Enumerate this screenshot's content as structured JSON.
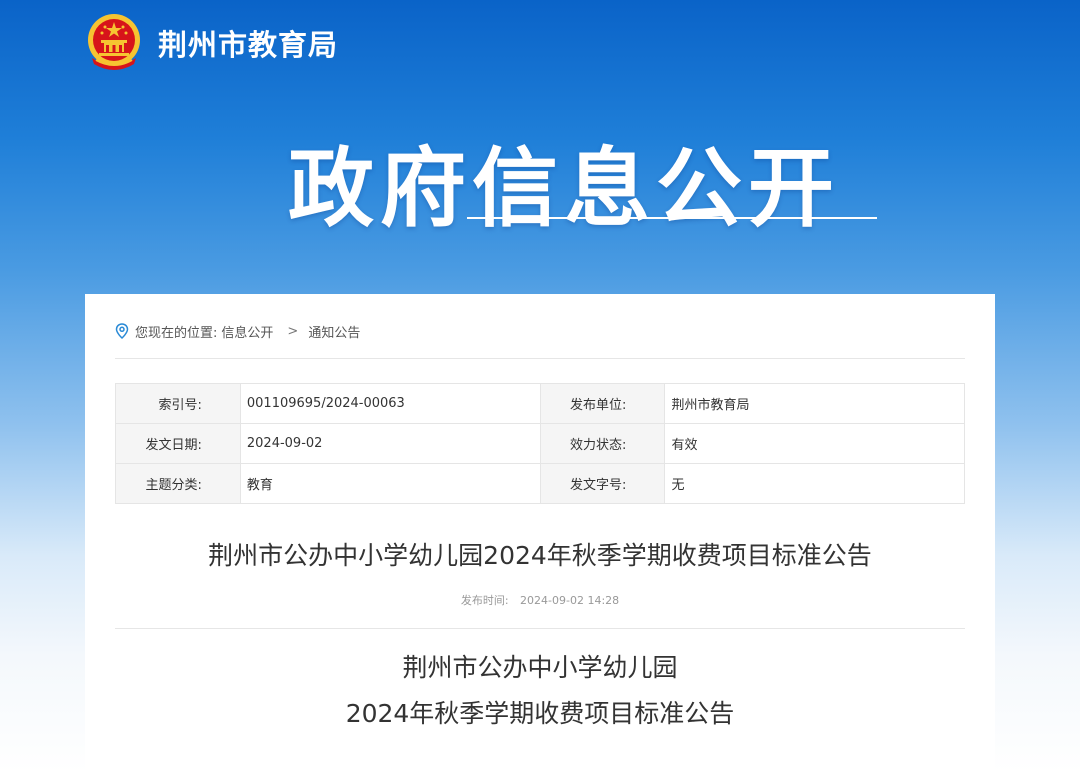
{
  "header": {
    "site_name": "荆州市教育局",
    "hero_title": "政府信息公开"
  },
  "breadcrumb": {
    "prefix": "您现在的位置:",
    "items": [
      "信息公开",
      "通知公告"
    ],
    "separator": ">"
  },
  "meta": [
    {
      "label1": "索引号:",
      "value1": "001109695/2024-00063",
      "label2": "发布单位:",
      "value2": "荆州市教育局"
    },
    {
      "label1": "发文日期:",
      "value1": "2024-09-02",
      "label2": "效力状态:",
      "value2": "有效"
    },
    {
      "label1": "主题分类:",
      "value1": "教育",
      "label2": "发文字号:",
      "value2": "无"
    }
  ],
  "article": {
    "title": "荆州市公办中小学幼儿园2024年秋季学期收费项目标准公告",
    "publish_label": "发布时间:",
    "publish_time": "2024-09-02 14:28",
    "body_heading_line1": "荆州市公办中小学幼儿园",
    "body_heading_line2": "2024年秋季学期收费项目标准公告"
  },
  "colors": {
    "brand_blue": "#0a63c8",
    "emblem_red": "#d7141a",
    "emblem_gold": "#f6c431",
    "pin_blue": "#2a8ad6"
  }
}
